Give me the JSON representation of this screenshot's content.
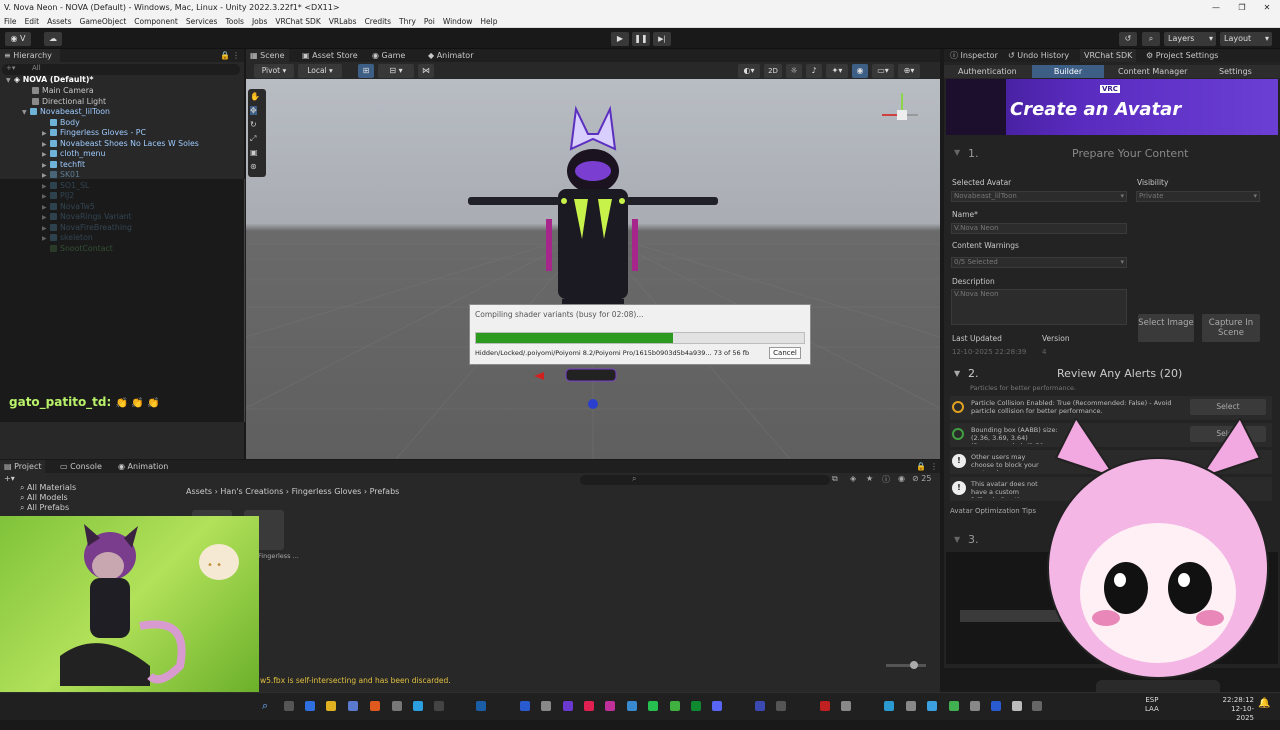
{
  "window": {
    "title": "V. Nova Neon - NOVA (Default) - Windows, Mac, Linux - Unity 2022.3.22f1* <DX11>",
    "minimize": "—",
    "maximize": "❐",
    "close": "✕"
  },
  "menu": [
    "File",
    "Edit",
    "Assets",
    "GameObject",
    "Component",
    "Services",
    "Tools",
    "Jobs",
    "VRChat SDK",
    "VRLabs",
    "Credits",
    "Thry",
    "Poi",
    "Window",
    "Help"
  ],
  "toolbar": {
    "account": "V",
    "play": "▶",
    "pause": "❚❚",
    "step": "▶|",
    "layers": "Layers",
    "layout": "Layout"
  },
  "hierarchy": {
    "tab": "Hierarchy",
    "search": "All",
    "rows": [
      {
        "label": "NOVA (Default)*",
        "depth": 0
      },
      {
        "label": "Main Camera",
        "depth": 1
      },
      {
        "label": "Directional Light",
        "depth": 1
      },
      {
        "label": "Novabeast_lilToon",
        "depth": 1
      },
      {
        "label": "Body",
        "depth": 2
      },
      {
        "label": "Fingerless Gloves - PC",
        "depth": 2
      },
      {
        "label": "Novabeast Shoes No Laces W Soles",
        "depth": 2
      },
      {
        "label": "cloth_menu",
        "depth": 2
      },
      {
        "label": "techfit",
        "depth": 2
      },
      {
        "label": "SK01",
        "depth": 2
      },
      {
        "label": "SO1_SL",
        "depth": 2
      },
      {
        "label": "PIJ2",
        "depth": 2
      },
      {
        "label": "NovaTw5",
        "depth": 2
      },
      {
        "label": "NovaRings Variant",
        "depth": 2
      },
      {
        "label": "NovaFireBreathing",
        "depth": 2
      },
      {
        "label": "skeleton",
        "depth": 2
      },
      {
        "label": "SnootContact",
        "depth": 2
      }
    ]
  },
  "chat": {
    "user": "gato_patito_td:",
    "message": "👏 👏 👏"
  },
  "scene": {
    "tabs": [
      "Scene",
      "Asset Store",
      "Game",
      "Animator"
    ],
    "pivot": "Pivot",
    "local": "Local",
    "mode2d": "2D"
  },
  "progress": {
    "title": "Compiling shader variants (busy for 02:08)...",
    "value": 0.6,
    "detail": "Hidden/Locked/.poiyomi/Poiyomi 8.2/Poiyomi Pro/1615b0903d5b4a939... 73 of 56 fb",
    "cancel": "Cancel"
  },
  "project": {
    "tabs": [
      "Project",
      "Console",
      "Animation"
    ],
    "favorites": [
      "All Materials",
      "All Models",
      "All Prefabs"
    ],
    "breadcrumb": [
      "Assets",
      "Han's Creations",
      "Fingerless Gloves",
      "Prefabs"
    ],
    "asset_label": "Fingerless ...",
    "count": "25",
    "status": "w5.fbx is self-intersecting and has been discarded."
  },
  "inspector": {
    "tabs": [
      "Inspector",
      "Undo History",
      "VRChat SDK",
      "Project Settings"
    ],
    "subtabs": [
      "Authentication",
      "Builder",
      "Content Manager",
      "Settings"
    ],
    "banner": {
      "badge": "VRC",
      "title": "Create an Avatar"
    },
    "step1": {
      "num": "1.",
      "title": "Prepare Your Content"
    },
    "selected_avatar_label": "Selected Avatar",
    "selected_avatar": "Novabeast_lilToon",
    "visibility_label": "Visibility",
    "visibility": "Private",
    "name_label": "Name*",
    "name": "V.Nova Neon",
    "warnings_label": "Content Warnings",
    "warnings": "0/5 Selected",
    "description_label": "Description",
    "description": "V.Nova Neon",
    "select_image": "Select Image",
    "capture": "Capture In Scene",
    "last_updated_label": "Last Updated",
    "last_updated": "12-10-2025 22:28:39",
    "version_label": "Version",
    "version": "4",
    "step2": {
      "num": "2.",
      "title": "Review Any Alerts (20)"
    },
    "alert_cut": "Particles for better performance.",
    "alerts": [
      {
        "text": "Particle Collision Enabled: True (Recommended: False) - Avoid particle collision for better performance.",
        "button": "Select"
      },
      {
        "text": "Bounding box (AABB) size: (2.36, 3.69, 3.64) (Recommended: (2.50, 2.50, 2.50))",
        "button": "Select"
      },
      {
        "text": "Other users may choose to block your avatar due to performance. Your fallback will be shown instead.",
        "button": ""
      },
      {
        "text": "This avatar does not have a custom fallback. See the documentation.",
        "button": ""
      }
    ],
    "tips": "Avatar Optimization Tips",
    "step3": {
      "num": "3."
    }
  },
  "taskbar": {
    "lang": "ESP",
    "lang2": "LAA",
    "time": "22:28:12",
    "date": "12-10-2025"
  },
  "colors": {
    "accent": "#2b9a1e",
    "banner": "#5a2bbf",
    "selection": "#2c5d87"
  }
}
